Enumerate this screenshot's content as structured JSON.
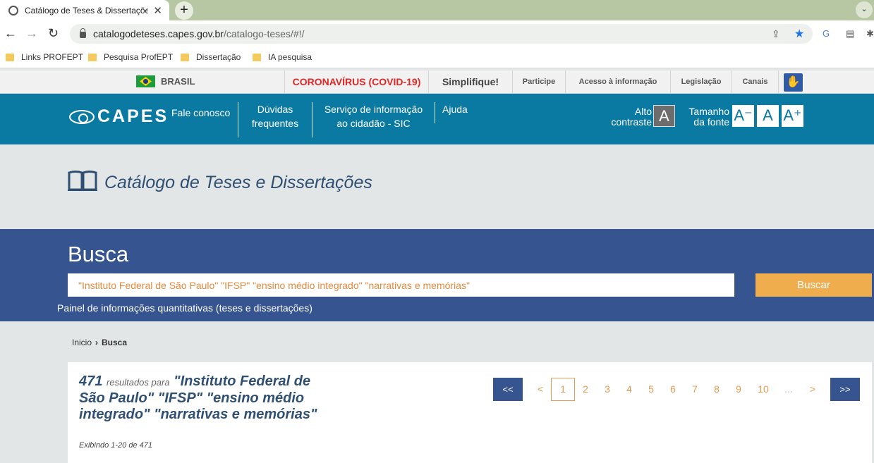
{
  "browser": {
    "tab_title": "Catálogo de Teses & Dissertações",
    "url_host": "catalogodeteses.capes.gov.br",
    "url_path": "/catalogo-teses/#!/",
    "bookmarks": [
      "Links PROFEPT",
      "Pesquisa ProfEPT",
      "Dissertação",
      "IA pesquisa"
    ]
  },
  "gov_bar": {
    "brasil": "BRASIL",
    "covid": "CORONAVÍRUS (COVID-19)",
    "simplifique": "Simplifique!",
    "participe": "Participe",
    "acesso": "Acesso à informação",
    "legislacao": "Legislação",
    "canais": "Canais"
  },
  "header": {
    "logo": "CAPES",
    "fale": "Fale conosco",
    "duvidas_1": "Dúvidas",
    "duvidas_2": "frequentes",
    "servico_1": "Serviço de informação",
    "servico_2": "ao cidadão - SIC",
    "ajuda": "Ajuda",
    "alto_1": "Alto",
    "alto_2": "contraste",
    "contrast_btn": "A",
    "tamanho_1": "Tamanho",
    "tamanho_2": "da fonte",
    "font_minus": "A⁻",
    "font_normal": "A",
    "font_plus": "A⁺"
  },
  "catalog": {
    "title": "Catálogo de Teses e Dissertações"
  },
  "search": {
    "heading": "Busca",
    "query": "\"Instituto Federal de São Paulo\" \"IFSP\" \"ensino médio integrado\"  \"narrativas e memórias\"",
    "button": "Buscar",
    "painel": "Painel de informações quantitativas (teses e dissertações)"
  },
  "breadcrumb": {
    "home": "Inicio",
    "current": "Busca"
  },
  "results": {
    "count": "471",
    "para": "resultados para",
    "query": "\"Instituto Federal de São Paulo\" \"IFSP\" \"ensino médio integrado\" \"narrativas e memórias\"",
    "showing": "Exibindo 1-20 de 471"
  },
  "pagination": {
    "first": "<<",
    "prev": "<",
    "pages": [
      "1",
      "2",
      "3",
      "4",
      "5",
      "6",
      "7",
      "8",
      "9",
      "10"
    ],
    "ellipsis": "...",
    "next": ">",
    "last": ">>"
  }
}
